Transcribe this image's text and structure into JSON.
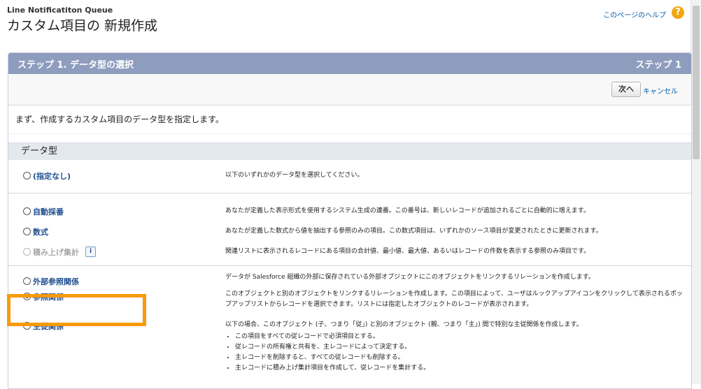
{
  "header": {
    "object_label": "Line Notificatiton Queue",
    "title": "カスタム項目の 新規作成",
    "help_link": "このページのヘルプ",
    "help_icon": "?"
  },
  "panel": {
    "step_title": "ステップ 1. データ型の選択",
    "step_label": "ステップ 1",
    "next_button": "次へ",
    "cancel_link": "キャンセル",
    "intro": "まず、作成するカスタム項目のデータ型を指定します。",
    "section_title": "データ型"
  },
  "options": {
    "none": {
      "label": "(指定なし)",
      "desc": "以下のいずれかのデータ型を選択してください。"
    },
    "autonumber": {
      "label": "自動採番",
      "desc": "あなたが定義した表示形式を使用するシステム生成の連番。この番号は、新しいレコードが追加されるごとに自動的に増えます。"
    },
    "formula": {
      "label": "数式",
      "desc": "あなたが定義した数式から値を抽出する参照のみの項目。この数式項目は、いずれかのソース項目が変更されたときに更新されます。"
    },
    "rollup": {
      "label": "積み上げ集計",
      "info": "i",
      "desc": "関連リストに表示されるレコードにある項目の合計値、最小値、最大値、あるいはレコードの件数を表示する参照のみ項目です。"
    },
    "external": {
      "label": "外部参照関係",
      "desc": "データが Salesforce 組織の外部に保存されている外部オブジェクトにこのオブジェクトをリンクするリレーションを作成します。"
    },
    "lookup": {
      "label": "参照関係",
      "desc": "このオブジェクトと別のオブジェクトをリンクするリレーションを作成します。この項目によって、ユーザはルックアップアイコンをクリックして表示されるポップアップリストからレコードを選択できます。リストには指定したオブジェクトのレコードが表示されます。"
    },
    "master": {
      "label": "主従関係",
      "desc": "以下の場合、このオブジェクト (子、つまり「従」) と別のオブジェクト (親、つまり「主」) 間で特別な主従関係を作成します。",
      "bullets": [
        "この項目をすべての従レコードで必須項目とする。",
        "従レコードの所有権と共有を、主レコードによって決定する。",
        "主レコードを削除すると、すべての従レコードも削除する。",
        "主レコードに積み上げ集計項目を作成して、従レコードを集計する。"
      ]
    }
  },
  "colors": {
    "accent": "#f79b0b",
    "header_bar": "#8e9dbe",
    "link": "#015ba7"
  }
}
